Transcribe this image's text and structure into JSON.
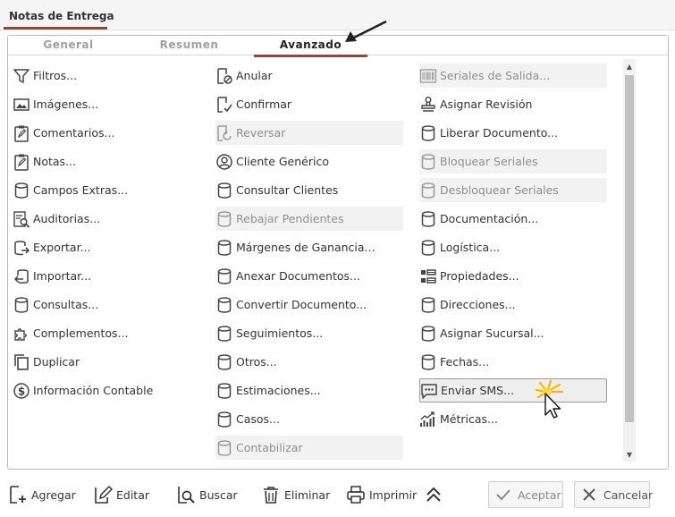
{
  "window": {
    "title": "Notas de Entrega"
  },
  "tabs": [
    {
      "label": "General"
    },
    {
      "label": "Resumen"
    },
    {
      "label": "Avanzado"
    }
  ],
  "columns": [
    {
      "items": [
        {
          "label": "Filtros...",
          "icon": "filter-icon",
          "disabled": false
        },
        {
          "label": "Imágenes...",
          "icon": "image-icon",
          "disabled": false
        },
        {
          "label": "Comentarios...",
          "icon": "clipboard-icon",
          "disabled": false
        },
        {
          "label": "Notas...",
          "icon": "clipboard-icon",
          "disabled": false
        },
        {
          "label": "Campos Extras...",
          "icon": "database-icon",
          "disabled": false
        },
        {
          "label": "Auditorias...",
          "icon": "audit-icon",
          "disabled": false
        },
        {
          "label": "Exportar...",
          "icon": "export-icon",
          "disabled": false
        },
        {
          "label": "Importar...",
          "icon": "import-icon",
          "disabled": false
        },
        {
          "label": "Consultas...",
          "icon": "database-icon",
          "disabled": false
        },
        {
          "label": "Complementos...",
          "icon": "puzzle-icon",
          "disabled": false
        },
        {
          "label": "Duplicar",
          "icon": "copy-icon",
          "disabled": false
        },
        {
          "label": "Información Contable",
          "icon": "dollar-icon",
          "disabled": false
        }
      ]
    },
    {
      "items": [
        {
          "label": "Anular",
          "icon": "void-document-icon",
          "disabled": false
        },
        {
          "label": "Confirmar",
          "icon": "confirm-document-icon",
          "disabled": false
        },
        {
          "label": "Reversar",
          "icon": "revert-document-icon",
          "disabled": true
        },
        {
          "label": "Cliente Genérico",
          "icon": "user-circle-icon",
          "disabled": false
        },
        {
          "label": "Consultar Clientes",
          "icon": "database-icon",
          "disabled": false
        },
        {
          "label": "Rebajar Pendientes",
          "icon": "database-icon",
          "disabled": true
        },
        {
          "label": "Márgenes de Ganancia...",
          "icon": "database-icon",
          "disabled": false
        },
        {
          "label": "Anexar Documentos...",
          "icon": "database-icon",
          "disabled": false
        },
        {
          "label": "Convertir Documento...",
          "icon": "database-icon",
          "disabled": false
        },
        {
          "label": "Seguimientos...",
          "icon": "database-icon",
          "disabled": false
        },
        {
          "label": "Otros...",
          "icon": "database-icon",
          "disabled": false
        },
        {
          "label": "Estimaciones...",
          "icon": "database-icon",
          "disabled": false
        },
        {
          "label": "Casos...",
          "icon": "database-icon",
          "disabled": false
        },
        {
          "label": "Contabilizar",
          "icon": "database-icon",
          "disabled": true
        }
      ]
    },
    {
      "items": [
        {
          "label": "Seriales de Salida...",
          "icon": "barcode-icon",
          "disabled": true
        },
        {
          "label": "Asignar Revisión",
          "icon": "stamp-icon",
          "disabled": false
        },
        {
          "label": "Liberar Documento...",
          "icon": "database-icon",
          "disabled": false
        },
        {
          "label": "Bloquear Seriales",
          "icon": "database-icon",
          "disabled": true
        },
        {
          "label": "Desbloquear Seriales",
          "icon": "database-icon",
          "disabled": true
        },
        {
          "label": "Documentación...",
          "icon": "database-icon",
          "disabled": false
        },
        {
          "label": "Logística...",
          "icon": "database-icon",
          "disabled": false
        },
        {
          "label": "Propiedades...",
          "icon": "properties-icon",
          "disabled": false
        },
        {
          "label": "Direcciones...",
          "icon": "database-icon",
          "disabled": false
        },
        {
          "label": "Asignar Sucursal...",
          "icon": "database-icon",
          "disabled": false
        },
        {
          "label": "Fechas...",
          "icon": "database-icon",
          "disabled": false
        },
        {
          "label": "Enviar SMS...",
          "icon": "sms-icon",
          "disabled": false,
          "highlight": true
        },
        {
          "label": "Métricas...",
          "icon": "metrics-icon",
          "disabled": false
        }
      ]
    }
  ],
  "toolbar": {
    "add_label": "Agregar",
    "edit_label": "Editar",
    "search_label": "Buscar",
    "delete_label": "Eliminar",
    "print_label": "Imprimir",
    "accept_label": "Aceptar",
    "cancel_label": "Cancelar"
  },
  "colors": {
    "accent": "#8a4a3c",
    "icon": "#444444",
    "disabled_icon": "#9a9a9a"
  }
}
